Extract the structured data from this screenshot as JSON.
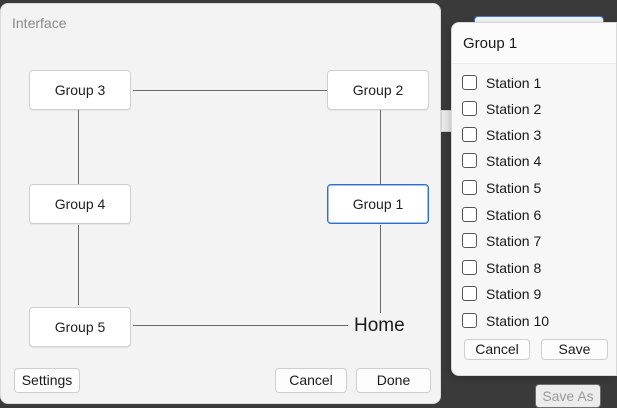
{
  "background": {
    "save_as_label": "Save As"
  },
  "main_panel": {
    "title": "Interface",
    "nodes": {
      "group3": "Group 3",
      "group2": "Group 2",
      "group4": "Group 4",
      "group1": "Group 1",
      "group5": "Group 5",
      "home": "Home"
    },
    "selected_node": "Group 1",
    "buttons": {
      "settings": "Settings",
      "cancel": "Cancel",
      "done": "Done"
    }
  },
  "popup": {
    "title": "Group 1",
    "stations": [
      {
        "label": "Station 1",
        "checked": false
      },
      {
        "label": "Station 2",
        "checked": false
      },
      {
        "label": "Station 3",
        "checked": false
      },
      {
        "label": "Station 4",
        "checked": false
      },
      {
        "label": "Station 5",
        "checked": false
      },
      {
        "label": "Station 6",
        "checked": false
      },
      {
        "label": "Station 7",
        "checked": false
      },
      {
        "label": "Station 8",
        "checked": false
      },
      {
        "label": "Station 9",
        "checked": false
      },
      {
        "label": "Station 10",
        "checked": false
      }
    ],
    "buttons": {
      "cancel": "Cancel",
      "save": "Save"
    }
  },
  "colors": {
    "accent": "#2f6fcc",
    "panel_bg": "#f3f3f3",
    "backdrop": "#3a3a3a"
  }
}
